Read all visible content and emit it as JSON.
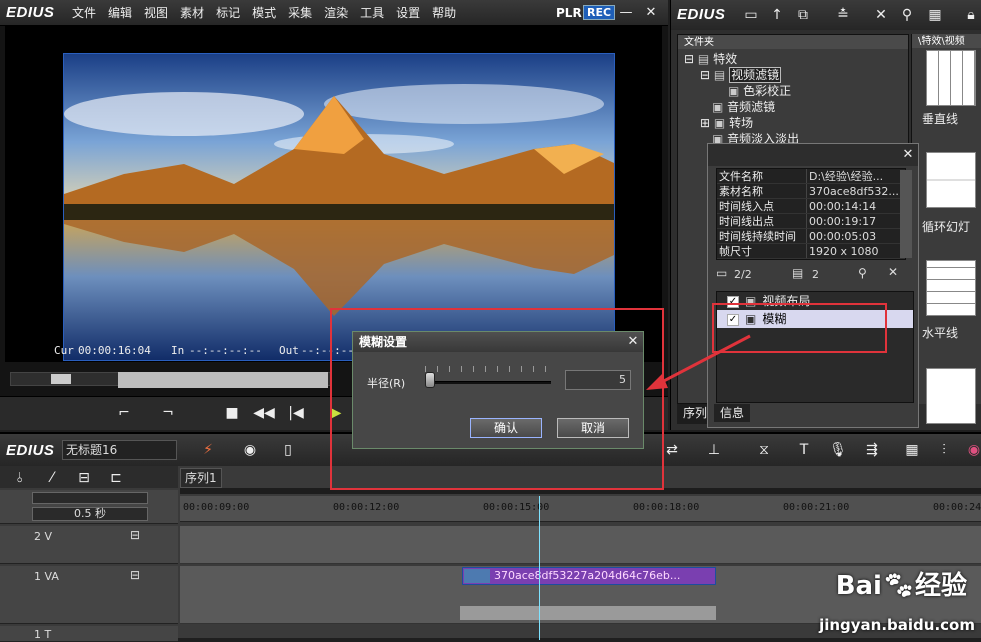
{
  "player": {
    "app_name": "EDIUS",
    "menu": [
      "文件",
      "编辑",
      "视图",
      "素材",
      "标记",
      "模式",
      "采集",
      "渲染",
      "工具",
      "设置",
      "帮助"
    ],
    "plr_label": "PLR",
    "rec_label": "REC",
    "cur_label": "Cur",
    "cur_value": "00:00:16:04",
    "in_label": "In",
    "in_value": "--:--:--:--",
    "out_label": "Out",
    "out_value": "--:--:--:--"
  },
  "bin": {
    "app_name": "EDIUS",
    "folder_panel_title": "文件夹",
    "thumbs_title": "\\特效\\视频",
    "tree": [
      {
        "label": "特效",
        "expander": "⊟"
      },
      {
        "label": "视频滤镜",
        "expander": "⊟"
      },
      {
        "label": "色彩校正",
        "expander": ""
      },
      {
        "label": "音频滤镜",
        "expander": ""
      },
      {
        "label": "转场",
        "expander": "⊞"
      },
      {
        "label": "音频淡入淡出",
        "expander": ""
      }
    ],
    "thumbs": [
      "垂直线",
      "循环幻灯",
      "水平线"
    ],
    "tabs": [
      "序列"
    ]
  },
  "info_palette": {
    "properties": [
      {
        "key": "文件名称",
        "value": "D:\\经验\\经验..."
      },
      {
        "key": "素材名称",
        "value": "370ace8df532..."
      },
      {
        "key": "时间线入点",
        "value": "00:00:14:14"
      },
      {
        "key": "时间线出点",
        "value": "00:00:19:17"
      },
      {
        "key": "时间线持续时间",
        "value": "00:00:05:03"
      },
      {
        "key": "帧尺寸",
        "value": "1920 x 1080"
      }
    ],
    "count_1": "2/2",
    "count_2": "2",
    "filters": [
      {
        "label": "视频布局",
        "checked": true,
        "selected": false
      },
      {
        "label": "模糊",
        "checked": true,
        "selected": true
      }
    ],
    "tab_info": "信息"
  },
  "blur_dialog": {
    "title": "模糊设置",
    "radius_label": "半径(R)",
    "radius_value": "5",
    "radius_fraction": 0.0,
    "ok_label": "确认",
    "cancel_label": "取消"
  },
  "timeline": {
    "app_name": "EDIUS",
    "project_name": "无标题16",
    "sequence_tab": "序列1",
    "zoom_label": "0.5 秒",
    "ruler_ticks": [
      "00:00:09:00",
      "00:00:12:00",
      "00:00:15:00",
      "00:00:18:00",
      "00:00:21:00",
      "00:00:24"
    ],
    "tracks": [
      {
        "name": "2 V"
      },
      {
        "name": "1 VA"
      },
      {
        "name": "1 T"
      }
    ],
    "clip_name": "370ace8df53227a204d64c76eb..."
  },
  "watermark": {
    "brand": "Bai",
    "brand2": "经验",
    "url": "jingyan.baidu.com"
  },
  "colors": {
    "accent": "#e0333b",
    "rec": "#1e5fb8",
    "clip": "#7a3fb0",
    "playhead": "#7fe3ff"
  }
}
